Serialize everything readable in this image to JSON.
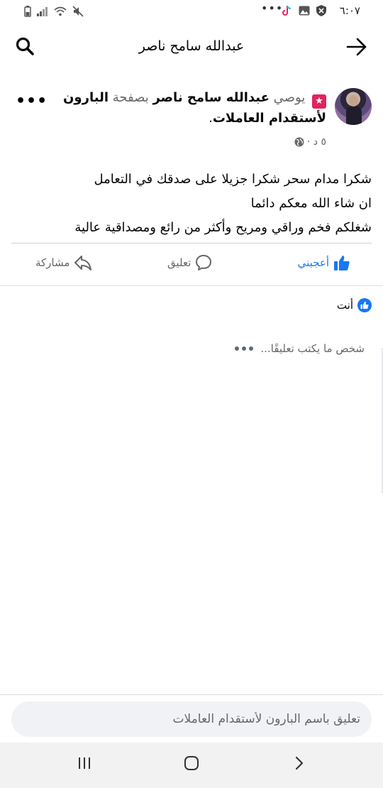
{
  "status_bar": {
    "time": "٦:٠٧",
    "dots": "•••",
    "icons": [
      "shield-icon",
      "gallery-icon",
      "tiktok-icon",
      "mute-icon",
      "wifi-icon",
      "signal-icon",
      "battery-icon"
    ]
  },
  "header": {
    "title": "عبدالله سامح ناصر",
    "icons": [
      "search-icon",
      "back-arrow-icon"
    ]
  },
  "post": {
    "author_pre": "يوصي",
    "author_name": "عبدالله سامح ناصر",
    "page_pre": "بصفحة",
    "page_name": "البارون لأستقدام العاملات",
    "period": ".",
    "time": "٥ د ·",
    "body_lines": [
      "شكرا مدام سحر شكرا جزيلا على صدقك في التعامل",
      "ان شاء الله معكم دائما",
      "شغلكم فخم وراقي ومريح وأكثر من رائع ومصداقية عالية"
    ],
    "more_label": "•••",
    "badge_icon": "recommend-star-icon",
    "accent": "#1877f2"
  },
  "actions": {
    "like": "أعجبني",
    "comment": "تعليق",
    "share": "مشاركة"
  },
  "reactions": {
    "label": "أنت"
  },
  "typing": {
    "text": "شخص ما يكتب تعليقًا..."
  },
  "composer": {
    "placeholder": "تعليق باسم البارون لأستقدام العاملات"
  },
  "navbar": {
    "icons": [
      "recent-apps-icon",
      "home-icon",
      "back-icon"
    ]
  }
}
